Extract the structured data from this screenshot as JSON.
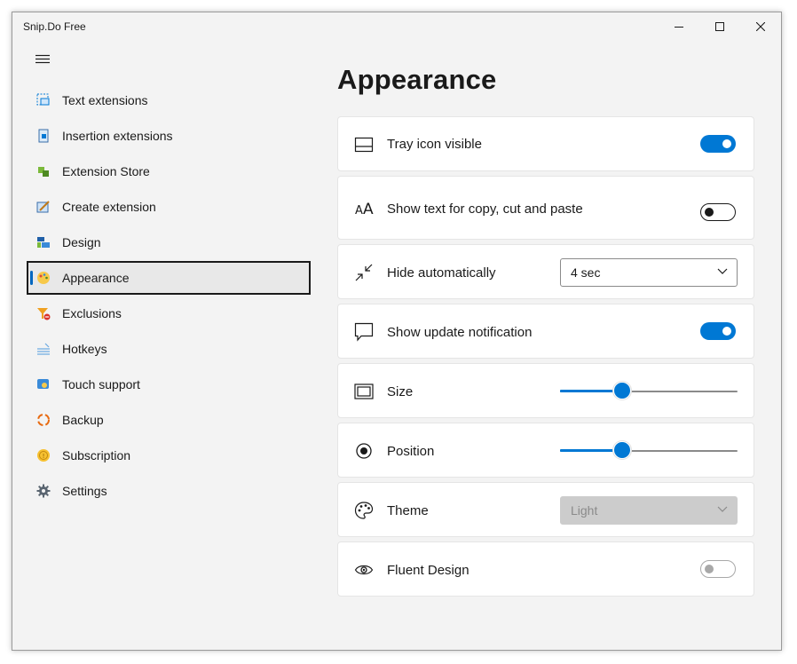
{
  "window": {
    "title": "Snip.Do Free"
  },
  "nav": {
    "items": [
      {
        "label": "Text extensions",
        "icon": "text-extensions-icon"
      },
      {
        "label": "Insertion extensions",
        "icon": "insertion-extensions-icon"
      },
      {
        "label": "Extension Store",
        "icon": "extension-store-icon"
      },
      {
        "label": "Create extension",
        "icon": "create-extension-icon"
      },
      {
        "label": "Design",
        "icon": "design-icon"
      },
      {
        "label": "Appearance",
        "icon": "appearance-icon",
        "selected": true
      },
      {
        "label": "Exclusions",
        "icon": "exclusions-icon"
      },
      {
        "label": "Hotkeys",
        "icon": "hotkeys-icon"
      },
      {
        "label": "Touch support",
        "icon": "touch-support-icon"
      },
      {
        "label": "Backup",
        "icon": "backup-icon"
      },
      {
        "label": "Subscription",
        "icon": "subscription-icon"
      },
      {
        "label": "Settings",
        "icon": "gear-icon"
      }
    ]
  },
  "page": {
    "title": "Appearance"
  },
  "settings": {
    "tray_icon": {
      "label": "Tray icon visible",
      "value": true
    },
    "show_text": {
      "label": "Show text for copy, cut and paste",
      "value": false
    },
    "hide_auto": {
      "label": "Hide automatically",
      "value": "4 sec"
    },
    "update_notification": {
      "label": "Show update notification",
      "value": true
    },
    "size": {
      "label": "Size",
      "value": 0.35
    },
    "position": {
      "label": "Position",
      "value": 0.35
    },
    "theme": {
      "label": "Theme",
      "value": "Light",
      "enabled": false
    },
    "fluent": {
      "label": "Fluent Design",
      "value": false,
      "enabled": false
    }
  },
  "colors": {
    "accent": "#0078d4",
    "background": "#f3f3f3",
    "card": "#ffffff"
  }
}
